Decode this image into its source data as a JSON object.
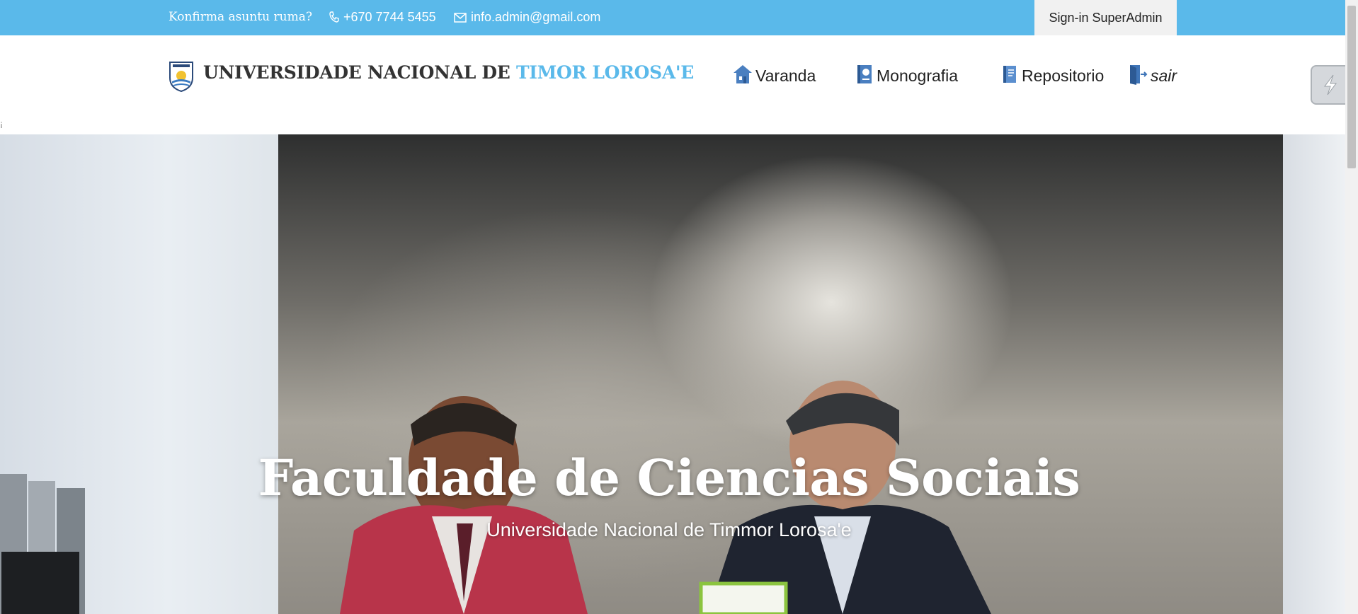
{
  "topbar": {
    "question": "Konfirma asuntu ruma?",
    "phone": "+670 7744 5455",
    "email": "info.admin@gmail.com",
    "signin_label": "Sign-in SuperAdmin"
  },
  "brand": {
    "name_main": "UNIVERSIDADE NACIONAL DE ",
    "name_accent": "TIMOR LOROSA'E"
  },
  "nav": {
    "items": [
      {
        "label": "Varanda",
        "icon": "home-icon"
      },
      {
        "label": "Monografia",
        "icon": "book-icon"
      },
      {
        "label": "Repositorio",
        "icon": "library-book-icon"
      },
      {
        "label": "sair",
        "icon": "logout-door-icon"
      }
    ]
  },
  "stray_text": "¡",
  "hero": {
    "title": "Faculdade de Ciencias Sociais",
    "subtitle": "Universidade Nacional de Timmor Lorosa'e"
  },
  "colors": {
    "accent": "#5ab9ea",
    "signin_bg": "#f1f1f1"
  }
}
